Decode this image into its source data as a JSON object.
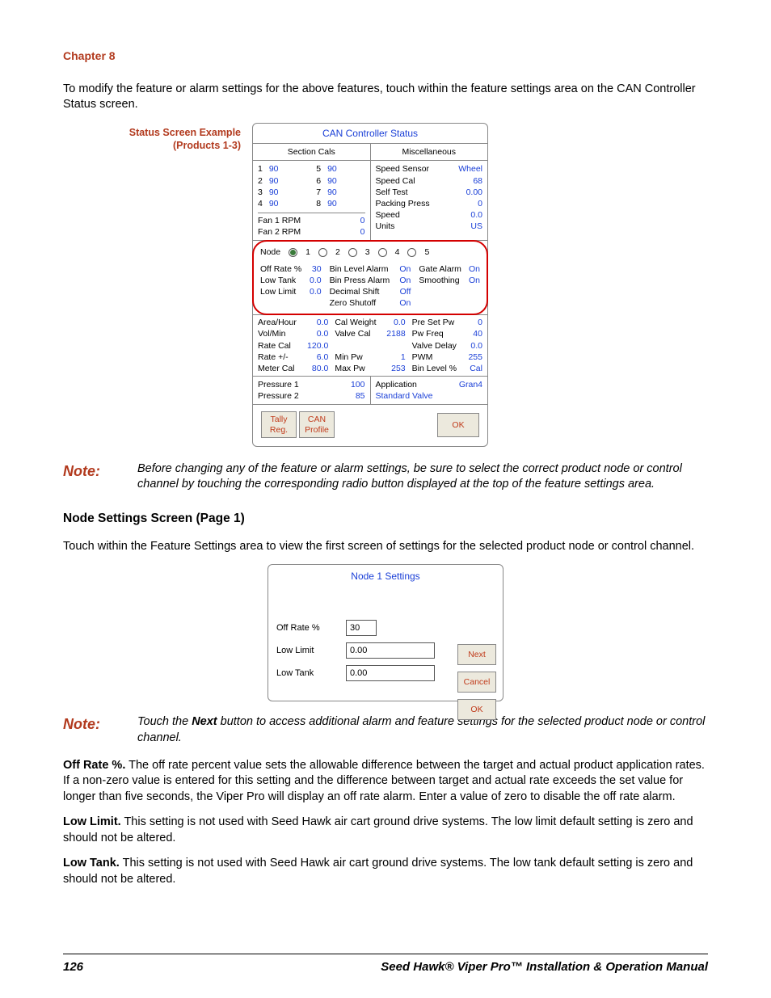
{
  "chapter": "Chapter 8",
  "intro": "To modify the feature or alarm settings for the above features, touch within the feature settings area on the CAN Controller Status screen.",
  "fig1_caption_l1": "Status Screen Example",
  "fig1_caption_l2": "(Products 1-3)",
  "can": {
    "title": "CAN Controller Status",
    "sec_head": "Section Cals",
    "misc_head": "Miscellaneous",
    "sec": {
      "c1": [
        [
          "1",
          "90"
        ],
        [
          "2",
          "90"
        ],
        [
          "3",
          "90"
        ],
        [
          "4",
          "90"
        ]
      ],
      "c2": [
        [
          "5",
          "90"
        ],
        [
          "6",
          "90"
        ],
        [
          "7",
          "90"
        ],
        [
          "8",
          "90"
        ]
      ]
    },
    "misc": [
      [
        "Speed Sensor",
        "Wheel"
      ],
      [
        "Speed Cal",
        "68"
      ],
      [
        "Self Test",
        "0.00"
      ],
      [
        "Packing Press",
        "0"
      ],
      [
        "Speed",
        "0.0"
      ],
      [
        "Units",
        "US"
      ]
    ],
    "fan1": [
      "Fan 1 RPM",
      "0"
    ],
    "fan2": [
      "Fan 2 RPM",
      "0"
    ],
    "node_label": "Node",
    "nodes": [
      "1",
      "2",
      "3",
      "4",
      "5"
    ],
    "left_kv": [
      [
        "Off Rate %",
        "30"
      ],
      [
        "Low Tank",
        "0.0"
      ],
      [
        "Low Limit",
        "0.0"
      ]
    ],
    "mid_kv": [
      [
        "Bin Level Alarm",
        "On"
      ],
      [
        "Bin Press Alarm",
        "On"
      ],
      [
        "Decimal Shift",
        "Off"
      ],
      [
        "Zero Shutoff",
        "On"
      ]
    ],
    "right_kv": [
      [
        "Gate Alarm",
        "On"
      ],
      [
        "Smoothing",
        "On"
      ]
    ],
    "below_left": [
      [
        "Area/Hour",
        "0.0"
      ],
      [
        "Vol/Min",
        "0.0"
      ],
      [
        "Rate Cal",
        "120.0"
      ],
      [
        "Rate +/-",
        "6.0"
      ],
      [
        "Meter Cal",
        "80.0"
      ]
    ],
    "below_mid": [
      [
        "Cal Weight",
        "0.0"
      ],
      [
        "Valve Cal",
        "2188"
      ],
      [
        "",
        ""
      ],
      [
        "Min Pw",
        "1"
      ],
      [
        "Max Pw",
        "253"
      ]
    ],
    "below_right": [
      [
        "Pre Set Pw",
        "0"
      ],
      [
        "Pw Freq",
        "40"
      ],
      [
        "Valve Delay",
        "0.0"
      ],
      [
        "PWM",
        "255"
      ],
      [
        "Bin Level %",
        "Cal"
      ]
    ],
    "press": [
      [
        "Pressure 1",
        "100"
      ],
      [
        "Pressure 2",
        "85"
      ]
    ],
    "app": [
      "Application",
      "Gran4"
    ],
    "valve": "Standard Valve",
    "btn_tally1": "Tally",
    "btn_tally2": "Reg.",
    "btn_can1": "CAN",
    "btn_can2": "Profile",
    "btn_ok": "OK"
  },
  "note1_label": "Note:",
  "note1": "Before changing any of the feature or alarm settings, be sure to select the correct product node or control channel by touching the corresponding radio button displayed at the top of the feature settings area.",
  "sec_heading": "Node Settings Screen (Page 1)",
  "sec_intro": "Touch within the Feature Settings area to view the first screen of settings for the selected product node or control channel.",
  "node1": {
    "title": "Node 1 Settings",
    "rows": [
      [
        "Off Rate %",
        "30"
      ],
      [
        "Low Limit",
        "0.00"
      ],
      [
        "Low Tank",
        "0.00"
      ]
    ],
    "btn_next": "Next",
    "btn_cancel": "Cancel",
    "btn_ok": "OK"
  },
  "note2_label": "Note:",
  "note2_pre": "Touch the ",
  "note2_bold": "Next",
  "note2_post": " button to access additional alarm and feature settings for the selected product node or control channel.",
  "para_off_h": "Off Rate %.",
  "para_off": " The off rate percent value sets the allowable difference between the target and actual product application rates. If a non-zero value is entered for this setting and the difference between target and actual rate exceeds the set value for longer than five seconds, the Viper Pro will display an off rate alarm. Enter a value of zero to disable the off rate alarm.",
  "para_ll_h": "Low Limit.",
  "para_ll": " This setting is not used with Seed Hawk air cart ground drive systems. The low limit default setting is zero and should not be altered.",
  "para_lt_h": "Low Tank.",
  "para_lt": " This setting is not used with Seed Hawk air cart ground drive systems. The low tank default setting is zero and should not be altered.",
  "footer_page": "126",
  "footer_title": "Seed Hawk® Viper Pro™ Installation & Operation Manual"
}
